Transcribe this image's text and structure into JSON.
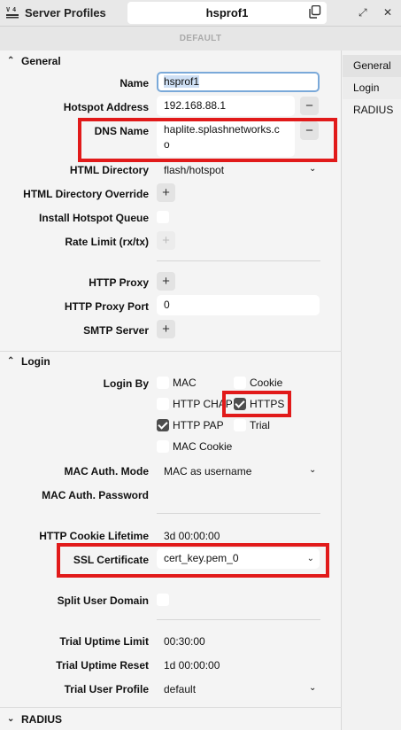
{
  "window": {
    "title": "Server Profiles",
    "profile_name": "hsprof1",
    "default_label": "DEFAULT",
    "minimize": "⤢",
    "close": "✕"
  },
  "sidebar": {
    "items": [
      {
        "label": "General"
      },
      {
        "label": "Login"
      },
      {
        "label": "RADIUS"
      }
    ]
  },
  "general": {
    "header": "General",
    "name_label": "Name",
    "name_value": "hsprof1",
    "hotspot_address_label": "Hotspot Address",
    "hotspot_address_value": "192.168.88.1",
    "dns_name_label": "DNS Name",
    "dns_name_line1": "haplite.splashnetworks.c",
    "dns_name_line2": "o",
    "html_directory_label": "HTML Directory",
    "html_directory_value": "flash/hotspot",
    "html_directory_override_label": "HTML Directory Override",
    "install_hotspot_queue_label": "Install Hotspot Queue",
    "rate_limit_label": "Rate Limit (rx/tx)",
    "http_proxy_label": "HTTP Proxy",
    "http_proxy_port_label": "HTTP Proxy Port",
    "http_proxy_port_value": "0",
    "smtp_server_label": "SMTP Server"
  },
  "login": {
    "header": "Login",
    "login_by_label": "Login By",
    "options": [
      {
        "label": "MAC",
        "checked": false
      },
      {
        "label": "Cookie",
        "checked": false
      },
      {
        "label": "HTTP CHAP",
        "checked": false
      },
      {
        "label": "HTTPS",
        "checked": true
      },
      {
        "label": "HTTP PAP",
        "checked": true
      },
      {
        "label": "Trial",
        "checked": false
      },
      {
        "label": "MAC Cookie",
        "checked": false
      }
    ],
    "mac_auth_mode_label": "MAC Auth. Mode",
    "mac_auth_mode_value": "MAC as username",
    "mac_auth_password_label": "MAC Auth. Password",
    "http_cookie_lifetime_label": "HTTP Cookie Lifetime",
    "http_cookie_lifetime_value": "3d 00:00:00",
    "ssl_certificate_label": "SSL Certificate",
    "ssl_certificate_value": "cert_key.pem_0",
    "split_user_domain_label": "Split User Domain",
    "trial_uptime_limit_label": "Trial Uptime Limit",
    "trial_uptime_limit_value": "00:30:00",
    "trial_uptime_reset_label": "Trial Uptime Reset",
    "trial_uptime_reset_value": "1d 00:00:00",
    "trial_user_profile_label": "Trial User Profile",
    "trial_user_profile_value": "default"
  },
  "radius": {
    "header": "RADIUS"
  },
  "colors": {
    "highlight": "#e11a1a",
    "focus_border": "#7aa9d9"
  }
}
